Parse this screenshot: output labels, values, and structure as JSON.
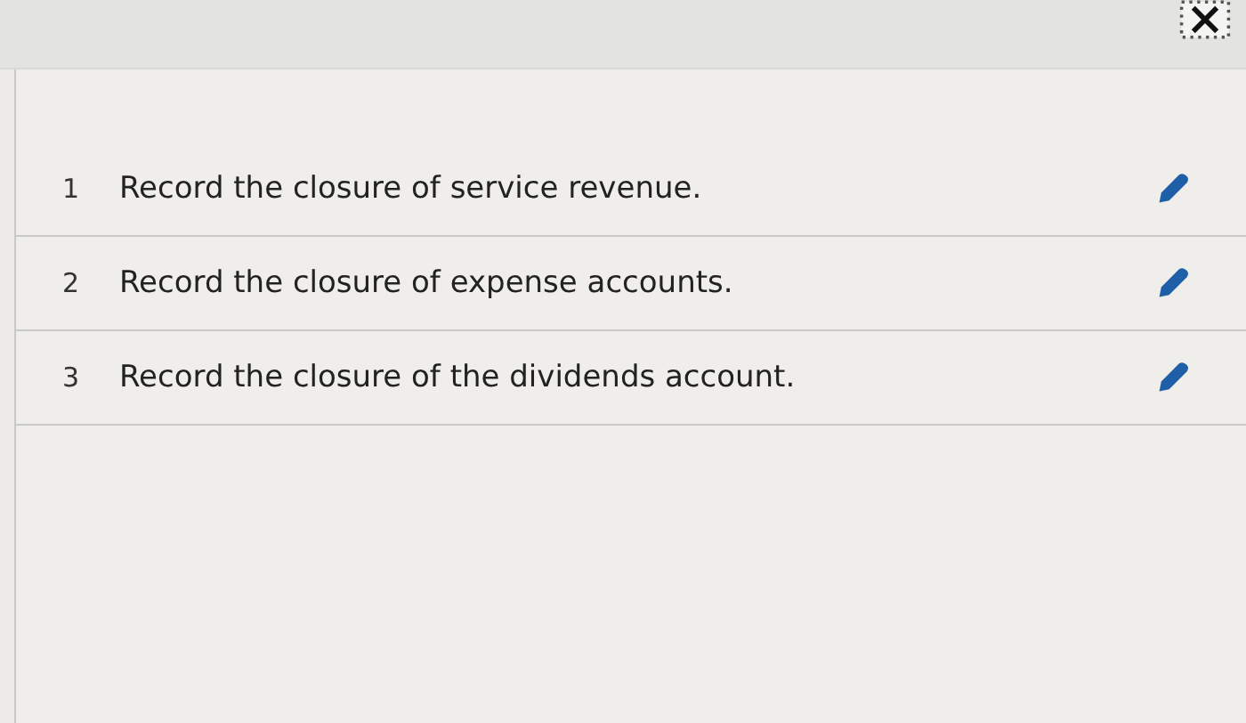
{
  "rows": [
    {
      "number": "1",
      "text": "Record the closure of service revenue."
    },
    {
      "number": "2",
      "text": "Record the closure of expense accounts."
    },
    {
      "number": "3",
      "text": "Record the closure of the dividends account."
    }
  ]
}
